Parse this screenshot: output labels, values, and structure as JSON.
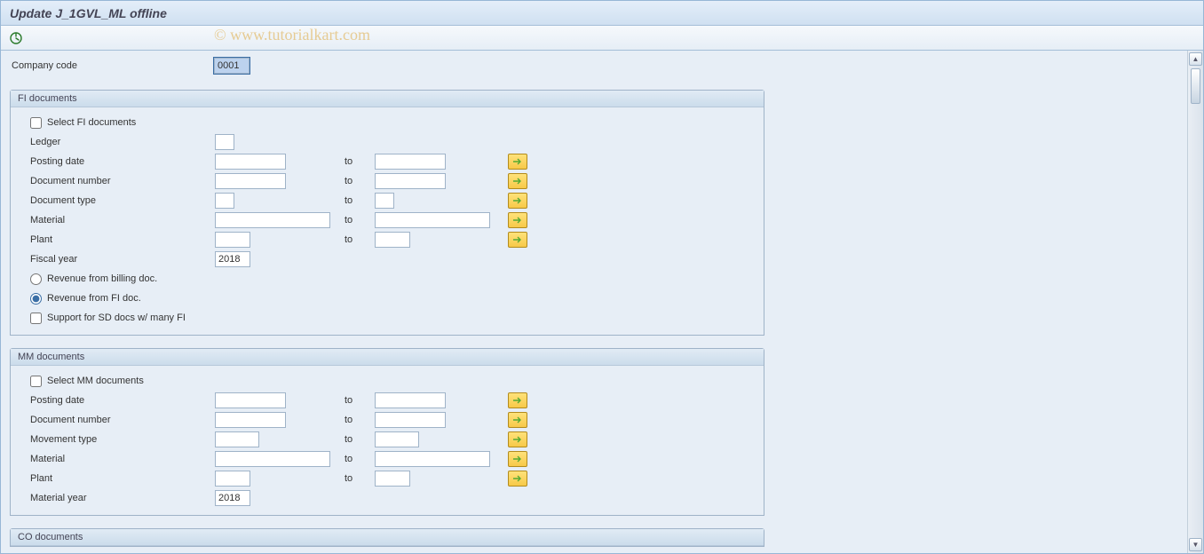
{
  "title": "Update J_1GVL_ML offline",
  "watermark": "© www.tutorialkart.com",
  "company_code": {
    "label": "Company code",
    "value": "0001"
  },
  "to_label": "to",
  "groups": {
    "fi": {
      "title": "FI documents",
      "select": {
        "label": "Select FI documents",
        "checked": false
      },
      "ledger": {
        "label": "Ledger",
        "value": ""
      },
      "posting_date": {
        "label": "Posting date",
        "from": "",
        "to": ""
      },
      "doc_number": {
        "label": "Document number",
        "from": "",
        "to": ""
      },
      "doc_type": {
        "label": "Document type",
        "from": "",
        "to": ""
      },
      "material": {
        "label": "Material",
        "from": "",
        "to": ""
      },
      "plant": {
        "label": "Plant",
        "from": "",
        "to": ""
      },
      "fiscal_year": {
        "label": "Fiscal year",
        "value": "2018"
      },
      "radio_billing": {
        "label": "Revenue from billing doc.",
        "checked": false
      },
      "radio_fi": {
        "label": "Revenue from FI doc.",
        "checked": true
      },
      "support_sd": {
        "label": "Support for SD docs w/ many FI",
        "checked": false
      }
    },
    "mm": {
      "title": "MM documents",
      "select": {
        "label": "Select MM documents",
        "checked": false
      },
      "posting_date": {
        "label": "Posting date",
        "from": "",
        "to": ""
      },
      "doc_number": {
        "label": "Document number",
        "from": "",
        "to": ""
      },
      "mvmt_type": {
        "label": "Movement type",
        "from": "",
        "to": ""
      },
      "material": {
        "label": "Material",
        "from": "",
        "to": ""
      },
      "plant": {
        "label": "Plant",
        "from": "",
        "to": ""
      },
      "material_year": {
        "label": "Material year",
        "value": "2018"
      }
    },
    "co": {
      "title": "CO documents"
    }
  }
}
